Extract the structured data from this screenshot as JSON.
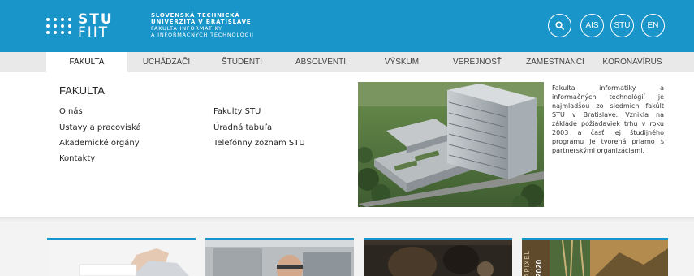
{
  "header": {
    "logo_line1": "STU",
    "logo_line2": "FIIT",
    "university_line1": "SLOVENSKÁ TECHNICKÁ",
    "university_line2": "UNIVERZITA V BRATISLAVE",
    "faculty_line1": "FAKULTA INFORMATIKY",
    "faculty_line2": "A INFORMAČNÝCH TECHNOLÓGIÍ",
    "buttons": [
      "AIS",
      "STU",
      "EN"
    ],
    "search_icon": "search-icon"
  },
  "nav": {
    "items": [
      "FAKULTA",
      "UCHÁDZAČI",
      "ŠTUDENTI",
      "ABSOLVENTI",
      "VÝSKUM",
      "VEREJNOSŤ",
      "ZAMESTNANCI",
      "KORONAVÍRUS"
    ]
  },
  "menu": {
    "title": "FAKULTA",
    "left_links": [
      "O nás",
      "Ústavy a pracoviská",
      "Akademické orgány",
      "Kontakty"
    ],
    "right_links": [
      "Fakulty STU",
      "Úradná tabuľa",
      "Telefónny zoznam STU"
    ],
    "description": "Fakulta informatiky a informačných technológií je najmladšou zo siedmich fakúlt STU v Bratislave. Vznikla na základe požiadaviek trhu v roku 2003 a časť jej študijného programu je tvorená priamo s partnerskými organizáciami."
  },
  "cards": {
    "card4_text_year": "2020",
    "card4_text_vertical": "APIXEL"
  },
  "colors": {
    "brand_blue": "#1a95c9",
    "nav_bg": "#e9e9e9"
  }
}
